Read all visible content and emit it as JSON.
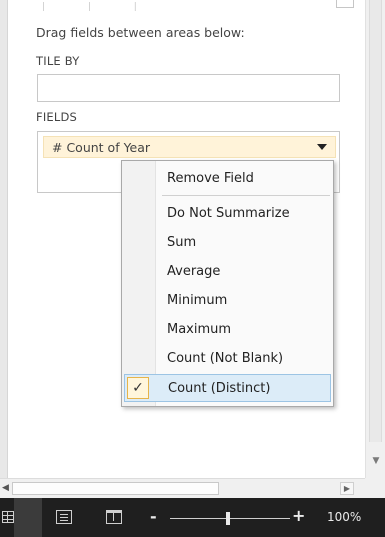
{
  "pane": {
    "hint": "Drag fields between areas below:",
    "tile_by_label": "TILE BY",
    "fields_label": "FIELDS",
    "field_chip": "# Count of Year"
  },
  "context_menu": {
    "items": [
      {
        "label": "Remove Field",
        "checked": false
      },
      {
        "label": "Do Not Summarize",
        "checked": false
      },
      {
        "label": "Sum",
        "checked": false
      },
      {
        "label": "Average",
        "checked": false
      },
      {
        "label": "Minimum",
        "checked": false
      },
      {
        "label": "Maximum",
        "checked": false
      },
      {
        "label": "Count (Not Blank)",
        "checked": false
      },
      {
        "label": "Count (Distinct)",
        "checked": true
      }
    ],
    "check_glyph": "✓"
  },
  "status_bar": {
    "zoom_minus": "-",
    "zoom_plus": "+",
    "zoom_percent": "100%",
    "zoom_level": 1.0
  },
  "colors": {
    "chip_bg": "#fff3d9",
    "menu_active_bg": "#dcecf8",
    "status_bg": "#1f1f1f"
  },
  "icons": {
    "field_dropdown": "chevron-down-icon",
    "normal_view": "grid-icon",
    "page_layout": "page-layout-icon",
    "page_break": "page-break-icon"
  }
}
